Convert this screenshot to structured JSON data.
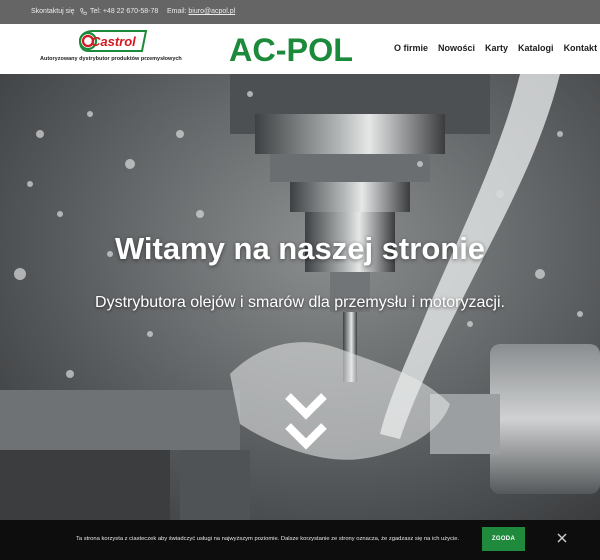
{
  "topbar": {
    "contact_label": "Skontaktuj się",
    "phone": "Tel: +48 22 670-58-78",
    "email_label": "Email:",
    "email_address": "biuro@acpol.pl"
  },
  "header": {
    "castrol_logo_text": "Castrol",
    "castrol_tagline": "Autoryzowany dystrybutor produktów przemysłowych",
    "brand_logo_text": "AC-POL",
    "nav": [
      "O firmie",
      "Nowości",
      "Karty",
      "Katalogi",
      "Kontakt"
    ]
  },
  "hero": {
    "title": "Witamy na naszej stronie",
    "subtitle": "Dystrybutora olejów i smarów dla przemysłu i motoryzacji."
  },
  "cookie": {
    "text": "Ta strona korzysta z ciasteczek aby świadczyć usługi na najwyższym poziomie. Dalsze korzystanie ze strony oznacza, że zgadzasz się na ich użycie.",
    "accept_label": "ZGODA"
  },
  "colors": {
    "topbar_bg": "#656565",
    "brand_green": "#1b8a3a",
    "castrol_red": "#d4171e",
    "cookie_bg": "#0d0d0d",
    "accept_green": "#1f8a3c"
  },
  "icons": {
    "phone": "phone-icon",
    "scroll": "double-chevron-down-icon",
    "close": "close-icon"
  }
}
